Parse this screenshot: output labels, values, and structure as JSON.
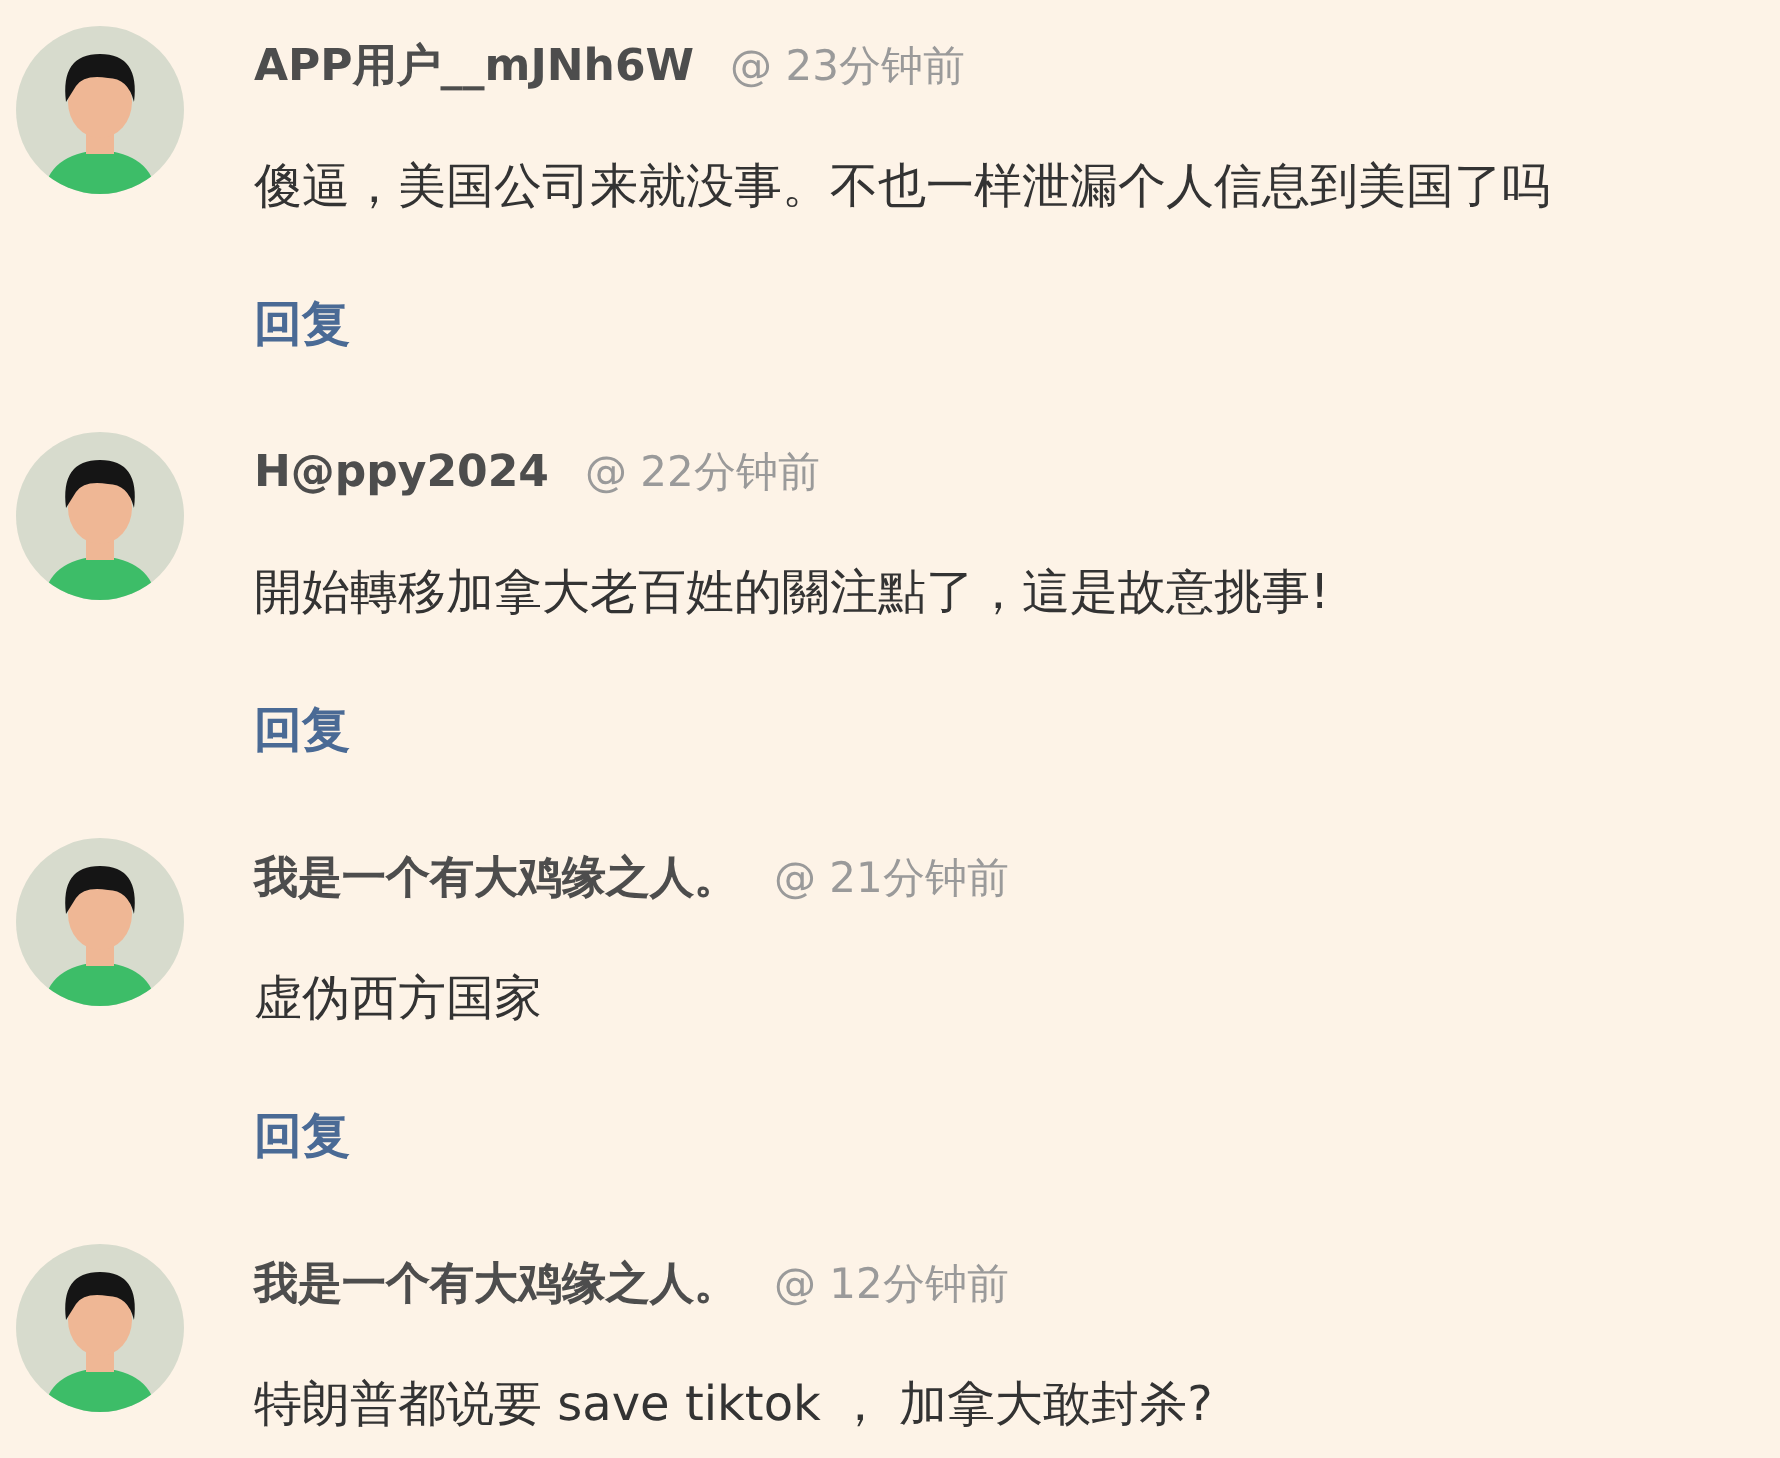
{
  "comments": [
    {
      "user": "APP用户__mJNh6W",
      "time": "@ 23分钟前",
      "text": "傻逼，美国公司来就没事。不也一样泄漏个人信息到美国了吗",
      "reply": "回复"
    },
    {
      "user": "H@ppy2024",
      "time": "@ 22分钟前",
      "text": "開始轉移加拿大老百姓的關注點了，這是故意挑事!",
      "reply": "回复"
    },
    {
      "user": "我是一个有大鸡缘之人。",
      "time": "@ 21分钟前",
      "text": "虚伪西方国家",
      "reply": "回复"
    },
    {
      "user": "我是一个有大鸡缘之人。",
      "time": "@ 12分钟前",
      "text": "特朗普都说要 save tiktok ， 加拿大敢封杀?"
    }
  ]
}
